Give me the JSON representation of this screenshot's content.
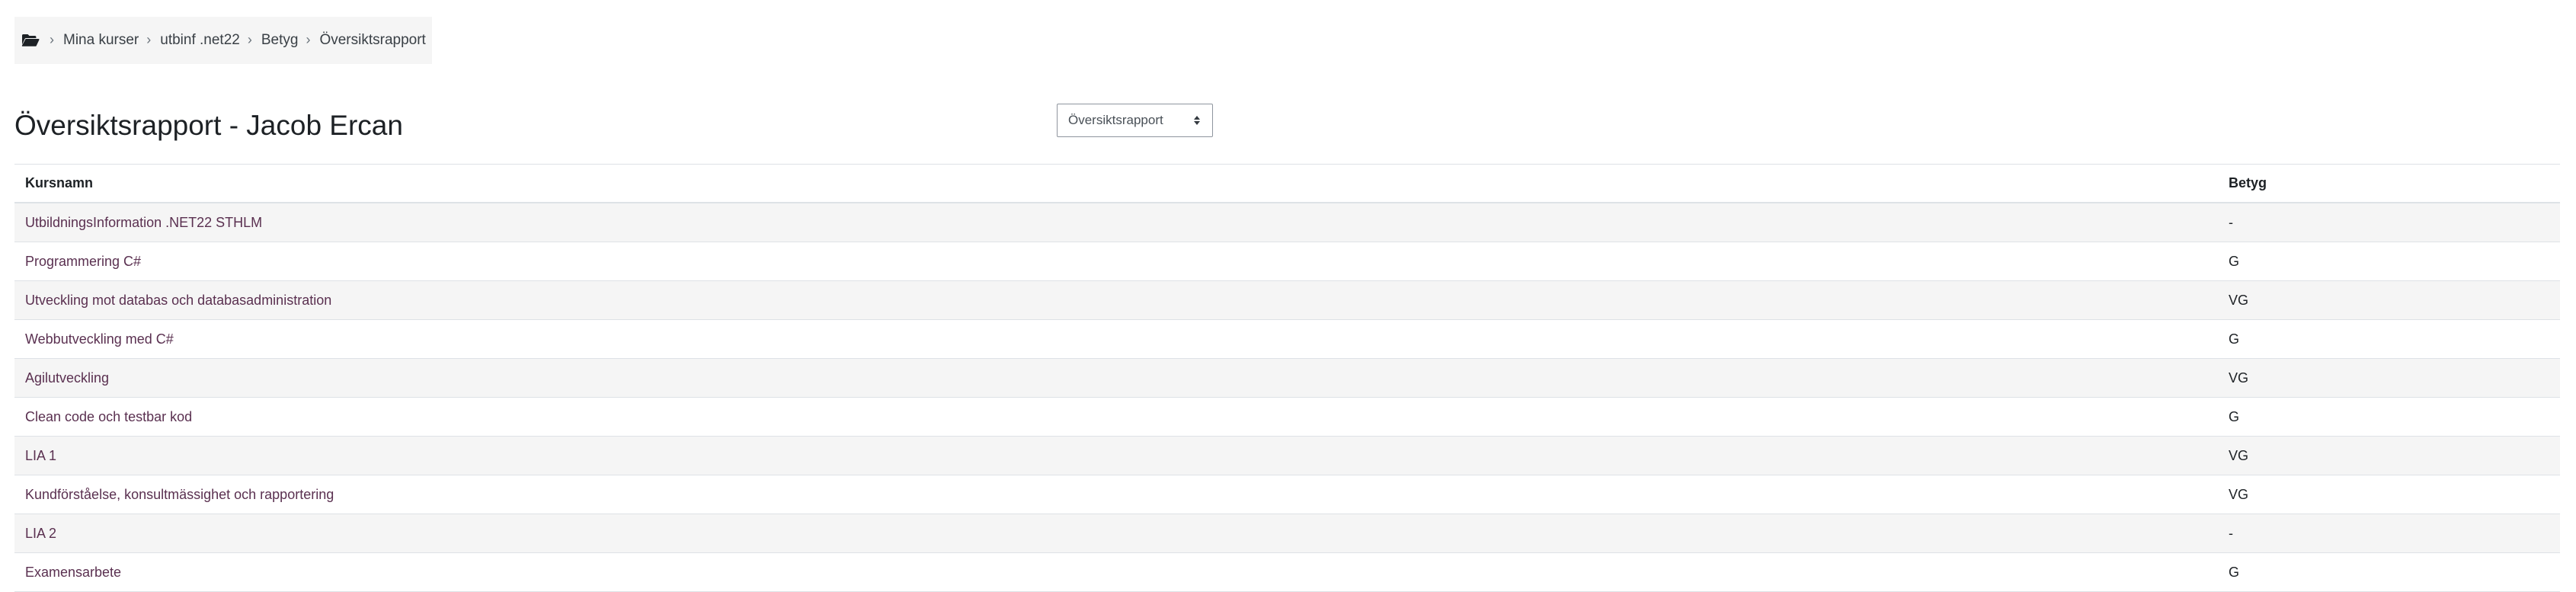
{
  "breadcrumb": {
    "home_icon": "folder-open-icon",
    "items": [
      {
        "label": "Mina kurser"
      },
      {
        "label": "utbinf .net22"
      },
      {
        "label": "Betyg"
      }
    ],
    "current": "Översiktsrapport"
  },
  "header": {
    "title": "Översiktsrapport - Jacob Ercan",
    "report_select": {
      "selected": "Översiktsrapport"
    }
  },
  "table": {
    "columns": [
      "Kursnamn",
      "Betyg"
    ],
    "rows": [
      {
        "course": "UtbildningsInformation .NET22 STHLM",
        "grade": "-"
      },
      {
        "course": "Programmering C#",
        "grade": "G"
      },
      {
        "course": "Utveckling mot databas och databasadministration",
        "grade": "VG"
      },
      {
        "course": "Webbutveckling med C#",
        "grade": "G"
      },
      {
        "course": "Agilutveckling",
        "grade": "VG"
      },
      {
        "course": "Clean code och testbar kod",
        "grade": "G"
      },
      {
        "course": "LIA 1",
        "grade": "VG"
      },
      {
        "course": "Kundförståelse, konsultmässighet och rapportering",
        "grade": "VG"
      },
      {
        "course": "LIA 2",
        "grade": "-"
      },
      {
        "course": "Examensarbete",
        "grade": "G"
      }
    ]
  },
  "colors": {
    "link": "#5a3050",
    "stripe": "#f5f5f5",
    "border": "#dee2e6"
  }
}
